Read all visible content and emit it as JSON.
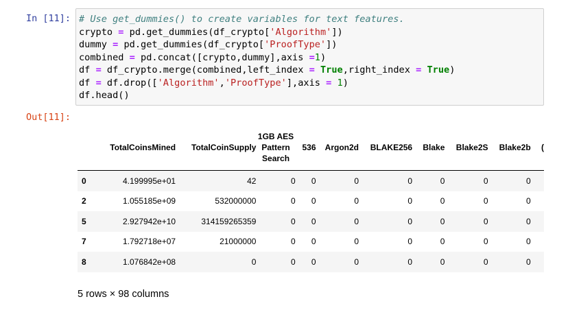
{
  "cell": {
    "in_prompt": "In [11]:",
    "out_prompt": "Out[11]:",
    "code_lines": [
      [
        {
          "t": "# Use get_dummies() to create variables for text features.",
          "c": "cm"
        }
      ],
      [
        {
          "t": "crypto "
        },
        {
          "t": "=",
          "c": "op"
        },
        {
          "t": " pd.get_dummies(df_crypto["
        },
        {
          "t": "'Algorithm'",
          "c": "st"
        },
        {
          "t": "])"
        }
      ],
      [
        {
          "t": "dummy "
        },
        {
          "t": "=",
          "c": "op"
        },
        {
          "t": " pd.get_dummies(df_crypto["
        },
        {
          "t": "'ProofType'",
          "c": "st"
        },
        {
          "t": "])"
        }
      ],
      [
        {
          "t": "combined "
        },
        {
          "t": "=",
          "c": "op"
        },
        {
          "t": " pd.concat([crypto,dummy],axis "
        },
        {
          "t": "=",
          "c": "op"
        },
        {
          "t": "1",
          "c": "nu"
        },
        {
          "t": ")"
        }
      ],
      [
        {
          "t": "df "
        },
        {
          "t": "=",
          "c": "op"
        },
        {
          "t": " df_crypto.merge(combined,left_index "
        },
        {
          "t": "=",
          "c": "op"
        },
        {
          "t": " "
        },
        {
          "t": "True",
          "c": "kw"
        },
        {
          "t": ",right_index "
        },
        {
          "t": "=",
          "c": "op"
        },
        {
          "t": " "
        },
        {
          "t": "True",
          "c": "kw"
        },
        {
          "t": ")"
        }
      ],
      [
        {
          "t": "df "
        },
        {
          "t": "=",
          "c": "op"
        },
        {
          "t": " df.drop(["
        },
        {
          "t": "'Algorithm'",
          "c": "st"
        },
        {
          "t": ","
        },
        {
          "t": "'ProofType'",
          "c": "st"
        },
        {
          "t": "],axis "
        },
        {
          "t": "=",
          "c": "op"
        },
        {
          "t": " "
        },
        {
          "t": "1",
          "c": "nu"
        },
        {
          "t": ")"
        }
      ],
      [
        {
          "t": "df.head()"
        }
      ]
    ]
  },
  "table": {
    "columns": [
      "",
      "TotalCoinsMined",
      "TotalCoinSupply",
      "1GB AES Pattern Search",
      "536",
      "Argon2d",
      "BLAKE256",
      "Blake",
      "Blake2S",
      "Blake2b",
      "("
    ],
    "rows": [
      [
        "0",
        "4.199995e+01",
        "42",
        "0",
        "0",
        "0",
        "0",
        "0",
        "0",
        "0"
      ],
      [
        "2",
        "1.055185e+09",
        "532000000",
        "0",
        "0",
        "0",
        "0",
        "0",
        "0",
        "0"
      ],
      [
        "5",
        "2.927942e+10",
        "314159265359",
        "0",
        "0",
        "0",
        "0",
        "0",
        "0",
        "0"
      ],
      [
        "7",
        "1.792718e+07",
        "21000000",
        "0",
        "0",
        "0",
        "0",
        "0",
        "0",
        "0"
      ],
      [
        "8",
        "1.076842e+08",
        "0",
        "0",
        "0",
        "0",
        "0",
        "0",
        "0",
        "0"
      ]
    ],
    "summary": "5 rows × 98 columns"
  }
}
